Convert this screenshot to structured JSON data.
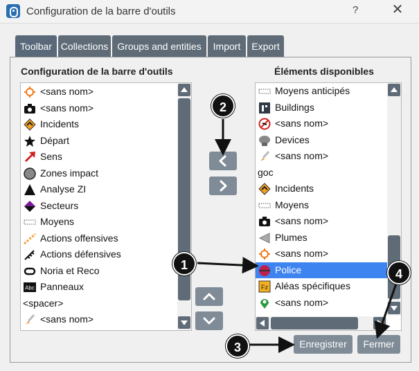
{
  "window": {
    "title": "Configuration de la barre d'outils",
    "help": "?",
    "close": "✕"
  },
  "tabs": [
    {
      "label": "Toolbar",
      "active": true
    },
    {
      "label": "Collections"
    },
    {
      "label": "Groups and entities"
    },
    {
      "label": "Import"
    },
    {
      "label": "Export"
    }
  ],
  "left_list": {
    "title": "Configuration de la barre d'outils",
    "items": [
      {
        "label": "<sans nom>",
        "icon": "crosshair-icon"
      },
      {
        "label": "<sans nom>",
        "icon": "camera-icon"
      },
      {
        "label": "Incidents",
        "icon": "incident-icon"
      },
      {
        "label": "Départ",
        "icon": "star-icon"
      },
      {
        "label": "Sens",
        "icon": "red-arrow-icon"
      },
      {
        "label": "Zones impact",
        "icon": "circle-icon"
      },
      {
        "label": "Analyse ZI",
        "icon": "triangle-icon"
      },
      {
        "label": "Secteurs",
        "icon": "sector-icon"
      },
      {
        "label": "Moyens",
        "icon": "dotted-line-icon"
      },
      {
        "label": "Actions offensives",
        "icon": "chain-icon"
      },
      {
        "label": "Actions défensives",
        "icon": "defense-icon"
      },
      {
        "label": "Noria et Reco",
        "icon": "loop-icon"
      },
      {
        "label": "Panneaux",
        "icon": "abc-icon"
      },
      {
        "label": "<spacer>",
        "icon": ""
      },
      {
        "label": "<sans nom>",
        "icon": "brush-icon"
      }
    ]
  },
  "right_list": {
    "title": "Éléments disponibles",
    "items": [
      {
        "label": "Moyens anticipés",
        "icon": "dotted-line-icon"
      },
      {
        "label": "Buildings",
        "icon": "building-icon"
      },
      {
        "label": "<sans nom>",
        "icon": "no-plane-icon"
      },
      {
        "label": "Devices",
        "icon": "device-icon"
      },
      {
        "label": "<sans nom>",
        "icon": "brush-icon"
      },
      {
        "label": "goc",
        "icon": ""
      },
      {
        "label": "Incidents",
        "icon": "incident-icon"
      },
      {
        "label": "Moyens",
        "icon": "dotted-line-icon"
      },
      {
        "label": "<sans nom>",
        "icon": "camera-icon"
      },
      {
        "label": "Plumes",
        "icon": "plume-icon"
      },
      {
        "label": "<sans nom>",
        "icon": "crosshair-icon"
      },
      {
        "label": "Police",
        "icon": "police-icon",
        "selected": true
      },
      {
        "label": "Aléas spécifiques",
        "icon": "hazard-icon"
      },
      {
        "label": "<sans nom>",
        "icon": "map-pin-icon"
      }
    ]
  },
  "buttons": {
    "move_left": "<",
    "move_right": ">",
    "move_up": "^",
    "move_down": "v",
    "save": "Enregistrer",
    "close": "Fermer"
  },
  "callouts": [
    "1",
    "2",
    "3",
    "4"
  ],
  "colors": {
    "tab_bg": "#5f6b77",
    "button_bg": "#7f8b96",
    "selection": "#3d84f0"
  }
}
